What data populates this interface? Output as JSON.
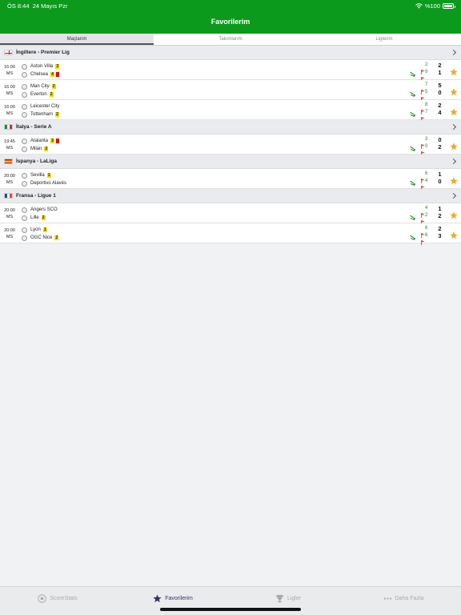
{
  "status_bar": {
    "time": "ÖS 8:44",
    "date": "24 Mayıs Pzr",
    "battery": "%100"
  },
  "nav": {
    "title": "Favorilerim"
  },
  "tabs": [
    {
      "label": "Maçlarım",
      "active": true
    },
    {
      "label": "Takımlarım",
      "active": false
    },
    {
      "label": "Liglerim",
      "active": false
    }
  ],
  "colors": {
    "brand": "#0b9a1c",
    "accent": "#3d2f6a",
    "star": "#f5a623",
    "yellow_card": "#ffd400",
    "red_card": "#e00000"
  },
  "leagues": [
    {
      "name": "İngiltere - Premier Lig",
      "flag": "england-flag",
      "matches": [
        {
          "time": "16:00",
          "status": "MS",
          "home": {
            "name": "Aston Villa",
            "yellow": "3",
            "red": false,
            "corners": "2",
            "score": "2"
          },
          "away": {
            "name": "Chelsea",
            "yellow": "4",
            "red": true,
            "corners": "9",
            "score": "1"
          }
        },
        {
          "time": "16:00",
          "status": "MS",
          "home": {
            "name": "Man City",
            "yellow": "2",
            "red": false,
            "corners": "7",
            "score": "5"
          },
          "away": {
            "name": "Everton",
            "yellow": "2",
            "red": false,
            "corners": "5",
            "score": "0"
          }
        },
        {
          "time": "16:00",
          "status": "MS",
          "home": {
            "name": "Leicester City",
            "yellow": "",
            "red": false,
            "corners": "8",
            "score": "2"
          },
          "away": {
            "name": "Tottenham",
            "yellow": "2",
            "red": false,
            "corners": "7",
            "score": "4"
          }
        }
      ]
    },
    {
      "name": "İtalya - Serie A",
      "flag": "italy-flag",
      "matches": [
        {
          "time": "19:45",
          "status": "MS",
          "home": {
            "name": "Atalanta",
            "yellow": "3",
            "red": true,
            "corners": "3",
            "score": "0"
          },
          "away": {
            "name": "Milan",
            "yellow": "2",
            "red": false,
            "corners": "0",
            "score": "2"
          }
        }
      ]
    },
    {
      "name": "İspanya - LaLiga",
      "flag": "spain-flag",
      "matches": [
        {
          "time": "20:00",
          "status": "MS",
          "home": {
            "name": "Sevilla",
            "yellow": "1",
            "red": false,
            "corners": "6",
            "score": "1"
          },
          "away": {
            "name": "Deportivo Alavés",
            "yellow": "",
            "red": false,
            "corners": "4",
            "score": "0"
          }
        }
      ]
    },
    {
      "name": "Fransa - Ligue 1",
      "flag": "france-flag",
      "matches": [
        {
          "time": "20:00",
          "status": "MS",
          "home": {
            "name": "Angers SCO",
            "yellow": "",
            "red": false,
            "corners": "4",
            "score": "1"
          },
          "away": {
            "name": "Lille",
            "yellow": "2",
            "red": false,
            "corners": "2",
            "score": "2"
          }
        },
        {
          "time": "20:00",
          "status": "MS",
          "home": {
            "name": "Lyon",
            "yellow": "1",
            "red": false,
            "corners": "6",
            "score": "2"
          },
          "away": {
            "name": "OGC Nice",
            "yellow": "2",
            "red": false,
            "corners": "6",
            "score": "3"
          }
        }
      ]
    }
  ],
  "bottom_nav": [
    {
      "label": "ScoreStats",
      "icon": "soccer-ball-icon",
      "active": false
    },
    {
      "label": "Favorilerim",
      "icon": "star-icon",
      "active": true
    },
    {
      "label": "Ligler",
      "icon": "trophy-icon",
      "active": false
    },
    {
      "label": "Daha Fazla",
      "icon": "more-dots-icon",
      "active": false
    }
  ]
}
